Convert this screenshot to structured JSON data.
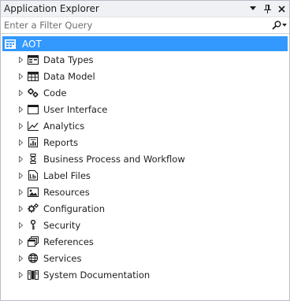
{
  "window": {
    "title": "Application Explorer",
    "dropdown_glyph": "▾",
    "pin_glyph": "⊓",
    "close_glyph": "✕"
  },
  "filter": {
    "placeholder": "Enter a Filter Query",
    "value": ""
  },
  "tree": {
    "root": {
      "label": "AOT",
      "icon": "aot-icon",
      "selected": true
    },
    "items": [
      {
        "label": "Data Types",
        "icon": "data-types-icon"
      },
      {
        "label": "Data Model",
        "icon": "data-model-icon"
      },
      {
        "label": "Code",
        "icon": "code-icon"
      },
      {
        "label": "User Interface",
        "icon": "user-interface-icon"
      },
      {
        "label": "Analytics",
        "icon": "analytics-icon"
      },
      {
        "label": "Reports",
        "icon": "reports-icon"
      },
      {
        "label": "Business Process and Workflow",
        "icon": "workflow-icon"
      },
      {
        "label": "Label Files",
        "icon": "label-files-icon"
      },
      {
        "label": "Resources",
        "icon": "resources-icon"
      },
      {
        "label": "Configuration",
        "icon": "configuration-icon"
      },
      {
        "label": "Security",
        "icon": "security-icon"
      },
      {
        "label": "References",
        "icon": "references-icon"
      },
      {
        "label": "Services",
        "icon": "services-icon"
      },
      {
        "label": "System Documentation",
        "icon": "system-documentation-icon"
      }
    ]
  },
  "colors": {
    "selection": "#3399ff",
    "titlebar": "#f0f1f4",
    "text": "#1e1e1e"
  }
}
